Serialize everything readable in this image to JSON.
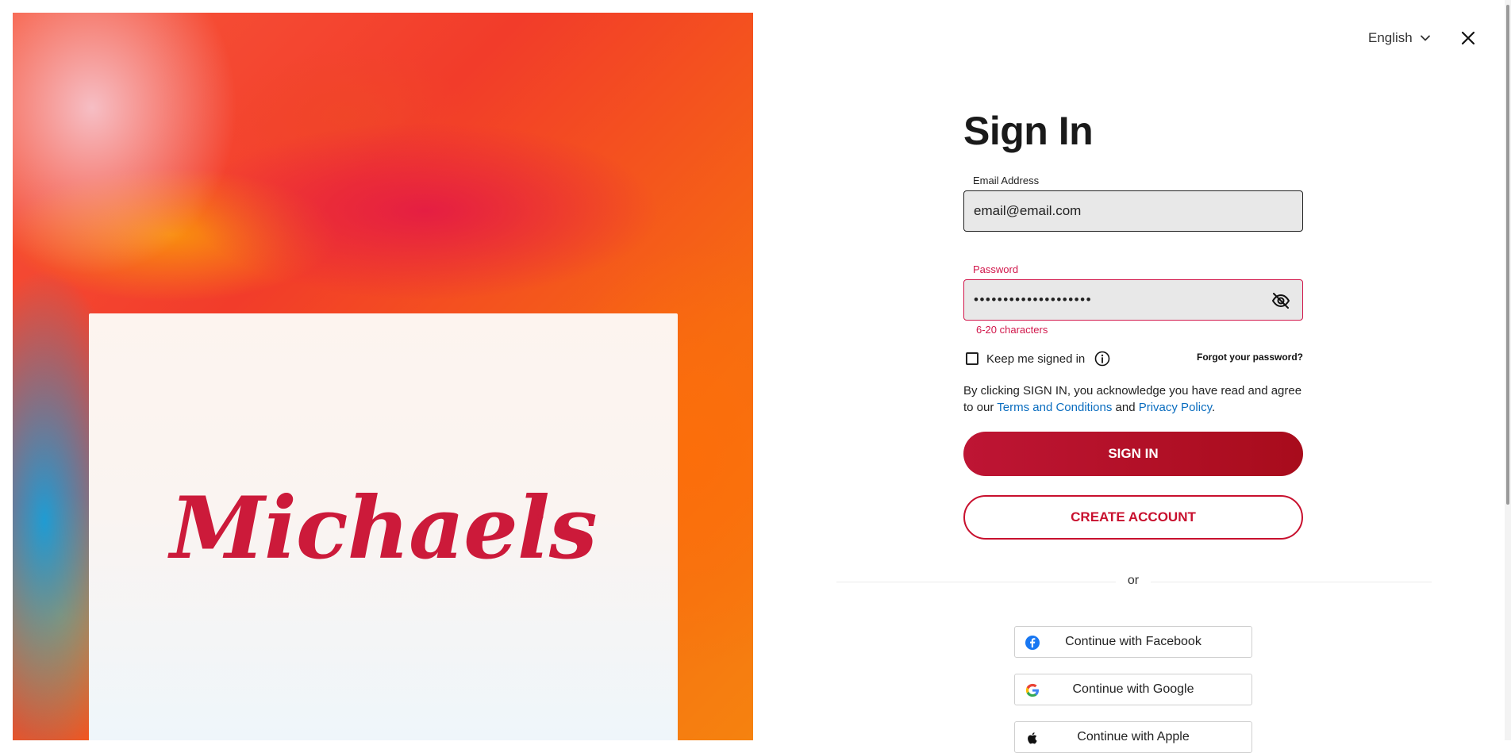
{
  "brand": {
    "logo_text": "Michaels",
    "registered_mark": "®",
    "color": "#cc1a3a"
  },
  "header": {
    "language": "English"
  },
  "form": {
    "title": "Sign In",
    "email": {
      "label": "Email Address",
      "value": "email@email.com"
    },
    "password": {
      "label": "Password",
      "value": "••••••••••••••••••••",
      "helper": "6-20 characters",
      "state": "error"
    },
    "keep_signed_in": {
      "label": "Keep me signed in",
      "checked": false
    },
    "forgot_password": "Forgot your password?",
    "terms": {
      "prefix": "By clicking SIGN IN, you acknowledge you have read and agree to our ",
      "terms_link": "Terms and Conditions",
      "middle": " and ",
      "privacy_link": "Privacy Policy",
      "suffix": "."
    },
    "sign_in_label": "SIGN IN",
    "create_account_label": "CREATE ACCOUNT",
    "divider_text": "or"
  },
  "social": [
    {
      "label": "Continue with Facebook",
      "icon": "facebook-icon"
    },
    {
      "label": "Continue with Google",
      "icon": "google-icon"
    },
    {
      "label": "Continue with Apple",
      "icon": "apple-icon"
    }
  ],
  "colors": {
    "primary": "#be1534",
    "error": "#d1174b",
    "link": "#0a6dbf"
  }
}
